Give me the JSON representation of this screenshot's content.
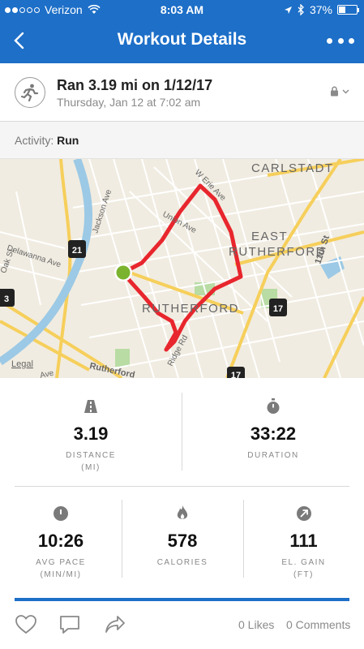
{
  "status_bar": {
    "carrier": "Verizon",
    "time": "8:03 AM",
    "battery": "37%",
    "battery_level": 0.37,
    "signal_bars": 2
  },
  "nav": {
    "title": "Workout Details",
    "back_icon": "chevron-left-icon",
    "more_icon": "more-horizontal-icon"
  },
  "workout": {
    "title": "Ran 3.19 mi on 1/12/17",
    "subtitle": "Thursday, Jan 12 at 7:02 am",
    "activity_icon": "runner-icon",
    "privacy_icon": "lock-icon"
  },
  "activity": {
    "label": "Activity:",
    "value": "Run"
  },
  "map": {
    "labels": [
      "CARLSTADT",
      "EAST",
      "RUTHERFORD",
      "RUTHERFORD",
      "Jackson Ave",
      "Union Ave",
      "W Erie Ave",
      "Delawanna Ave",
      "Oak St",
      "Ridge Rd",
      "11th St",
      "Rutherford",
      "Ave",
      "Legal"
    ],
    "shields": [
      "21",
      "3",
      "17",
      "17"
    ],
    "route_color": "#e8262d",
    "start_color": "#7bb32e"
  },
  "stats": {
    "distance": {
      "value": "3.19",
      "label": "DISTANCE",
      "unit": "(MI)",
      "icon": "road-icon"
    },
    "duration": {
      "value": "33:22",
      "label": "DURATION",
      "unit": "",
      "icon": "stopwatch-icon"
    },
    "pace": {
      "value": "10:26",
      "label": "AVG PACE",
      "unit": "(MIN/MI)",
      "icon": "speedometer-icon"
    },
    "calories": {
      "value": "578",
      "label": "CALORIES",
      "unit": "",
      "icon": "flame-icon"
    },
    "elevation": {
      "value": "111",
      "label": "EL. GAIN",
      "unit": "(FT)",
      "icon": "arrow-up-right-icon"
    }
  },
  "footer": {
    "likes": "0 Likes",
    "comments": "0 Comments",
    "icons": [
      "heart-icon",
      "comment-icon",
      "share-icon"
    ]
  },
  "colors": {
    "header": "#1d6fc8",
    "icon_gray": "#7a7a7a"
  }
}
